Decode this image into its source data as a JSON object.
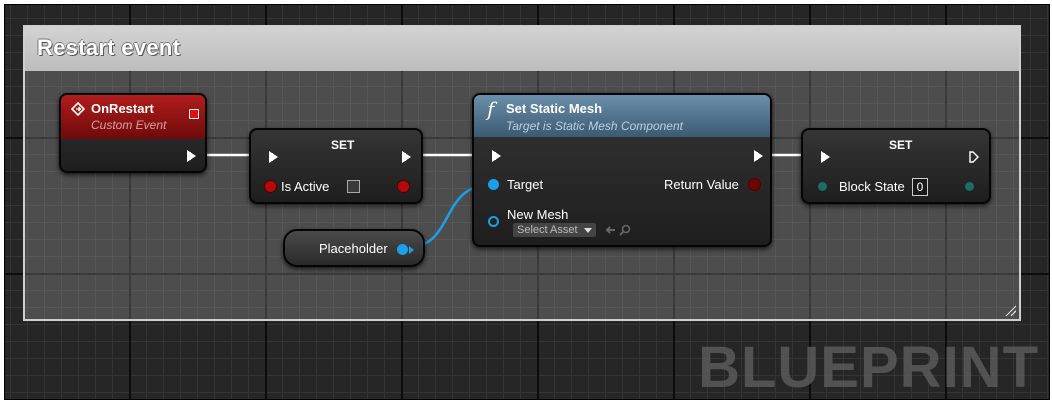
{
  "comment": {
    "title": "Restart event"
  },
  "nodes": {
    "on_restart": {
      "title": "OnRestart",
      "subtitle": "Custom Event"
    },
    "set_active": {
      "title": "SET",
      "pin_label": "Is Active"
    },
    "placeholder": {
      "label": "Placeholder"
    },
    "set_static_mesh": {
      "title": "Set Static Mesh",
      "subtitle": "Target is Static Mesh Component",
      "target_label": "Target",
      "return_label": "Return Value",
      "new_mesh_label": "New Mesh",
      "select_asset": "Select Asset"
    },
    "set_block": {
      "title": "SET",
      "pin_label": "Block State",
      "value": "0"
    }
  },
  "watermark": "BLUEPRINT",
  "colors": {
    "event_header": "#8a1111",
    "function_header": "#4b6f8c",
    "object_pin": "#1aa0e8",
    "bool_pin": "#b50a0a",
    "int_pin": "#1c6e62"
  },
  "icons": [
    "event-icon",
    "function-icon",
    "exec-pin-icon",
    "dropdown-arrow-icon",
    "use-asset-icon",
    "browse-icon"
  ]
}
